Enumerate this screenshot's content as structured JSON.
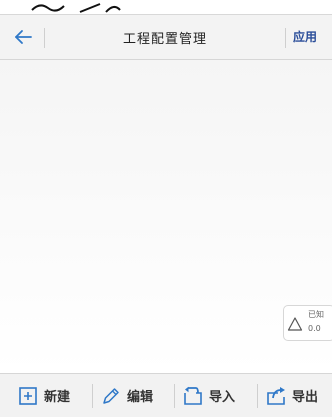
{
  "header": {
    "title": "工程配置管理",
    "apply_label": "应用"
  },
  "known_widget": {
    "label": "已知",
    "value": "0.0"
  },
  "toolbar": {
    "items": [
      {
        "label": "新建",
        "icon": "new-icon"
      },
      {
        "label": "编辑",
        "icon": "pencil-icon"
      },
      {
        "label": "导入",
        "icon": "import-icon"
      },
      {
        "label": "导出",
        "icon": "export-icon"
      }
    ]
  },
  "colors": {
    "accent": "#2b4e9a",
    "icon_blue": "#2f78c8",
    "toolbar_bg": "#f2f2f2"
  }
}
